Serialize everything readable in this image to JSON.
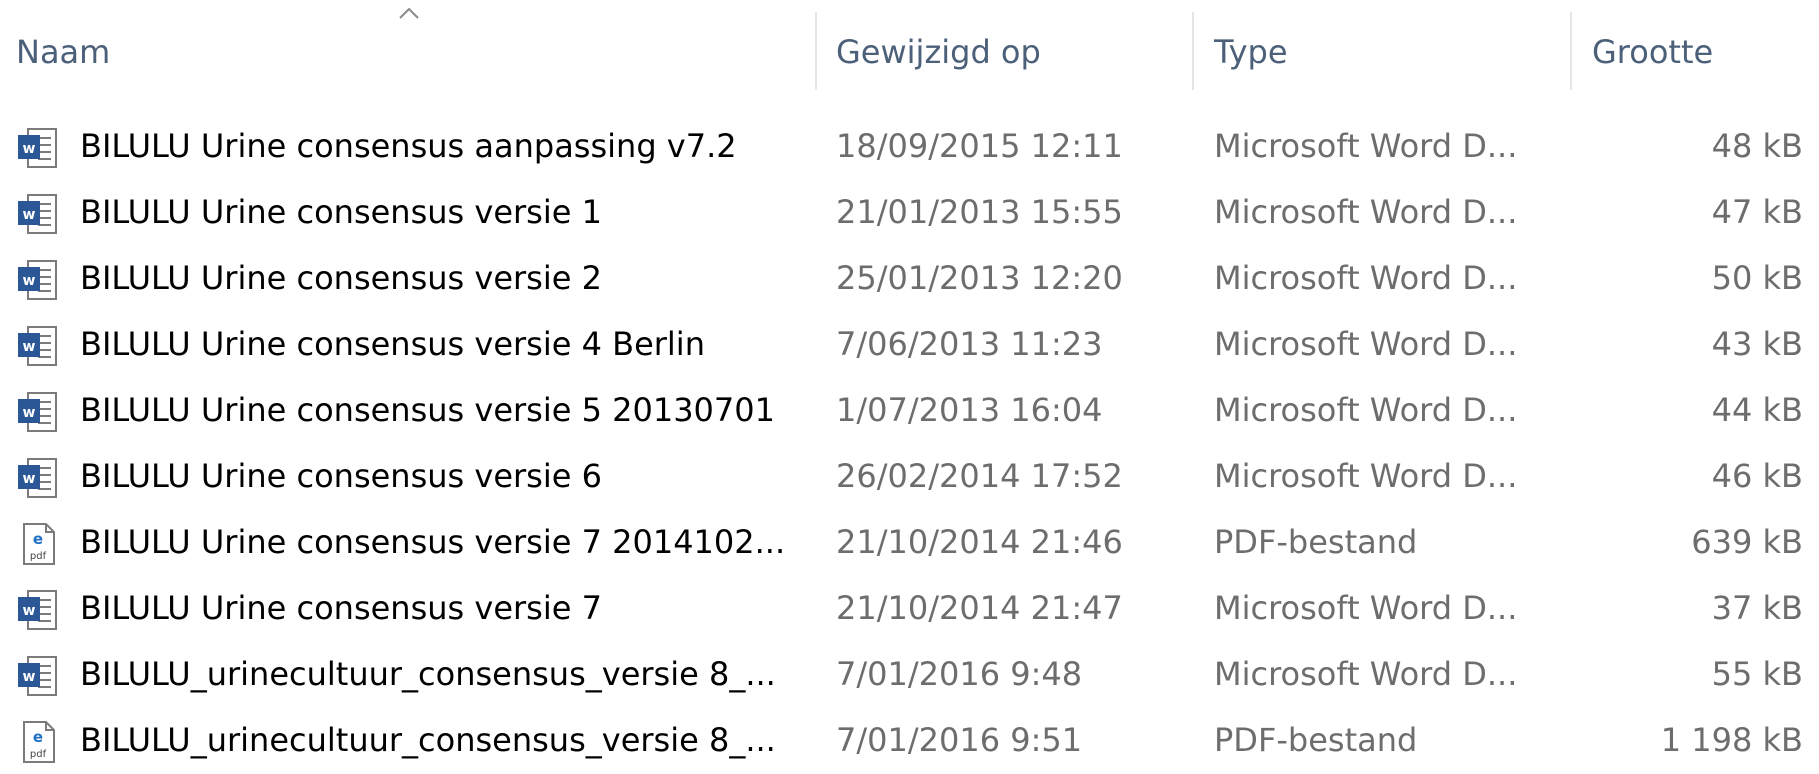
{
  "columns": {
    "name": "Naam",
    "modified": "Gewijzigd op",
    "type": "Type",
    "size": "Grootte"
  },
  "files": [
    {
      "icon": "word-doc-icon",
      "name": "BILULU Urine consensus aanpassing v7.2",
      "modified": "18/09/2015 12:11",
      "type": "Microsoft Word D...",
      "size": "48 kB"
    },
    {
      "icon": "word-doc-icon",
      "name": "BILULU Urine consensus versie 1",
      "modified": "21/01/2013 15:55",
      "type": "Microsoft Word D...",
      "size": "47 kB"
    },
    {
      "icon": "word-doc-icon",
      "name": "BILULU Urine consensus versie 2",
      "modified": "25/01/2013 12:20",
      "type": "Microsoft Word D...",
      "size": "50 kB"
    },
    {
      "icon": "word-doc-icon",
      "name": "BILULU Urine consensus versie 4 Berlin",
      "modified": "7/06/2013 11:23",
      "type": "Microsoft Word D...",
      "size": "43 kB"
    },
    {
      "icon": "word-doc-icon",
      "name": "BILULU Urine consensus versie 5 20130701",
      "modified": "1/07/2013 16:04",
      "type": "Microsoft Word D...",
      "size": "44 kB"
    },
    {
      "icon": "word-doc-icon",
      "name": "BILULU Urine consensus versie 6",
      "modified": "26/02/2014 17:52",
      "type": "Microsoft Word D...",
      "size": "46 kB"
    },
    {
      "icon": "pdf-doc-icon",
      "name": "BILULU Urine consensus versie 7 2014102...",
      "modified": "21/10/2014 21:46",
      "type": "PDF-bestand",
      "size": "639 kB"
    },
    {
      "icon": "word-doc-icon",
      "name": "BILULU Urine consensus versie 7",
      "modified": "21/10/2014 21:47",
      "type": "Microsoft Word D...",
      "size": "37 kB"
    },
    {
      "icon": "word-doc-icon",
      "name": "BILULU_urinecultuur_consensus_versie 8_...",
      "modified": "7/01/2016 9:48",
      "type": "Microsoft Word D...",
      "size": "55 kB"
    },
    {
      "icon": "pdf-doc-icon",
      "name": "BILULU_urinecultuur_consensus_versie 8_...",
      "modified": "7/01/2016 9:51",
      "type": "PDF-bestand",
      "size": "1 198 kB"
    }
  ]
}
